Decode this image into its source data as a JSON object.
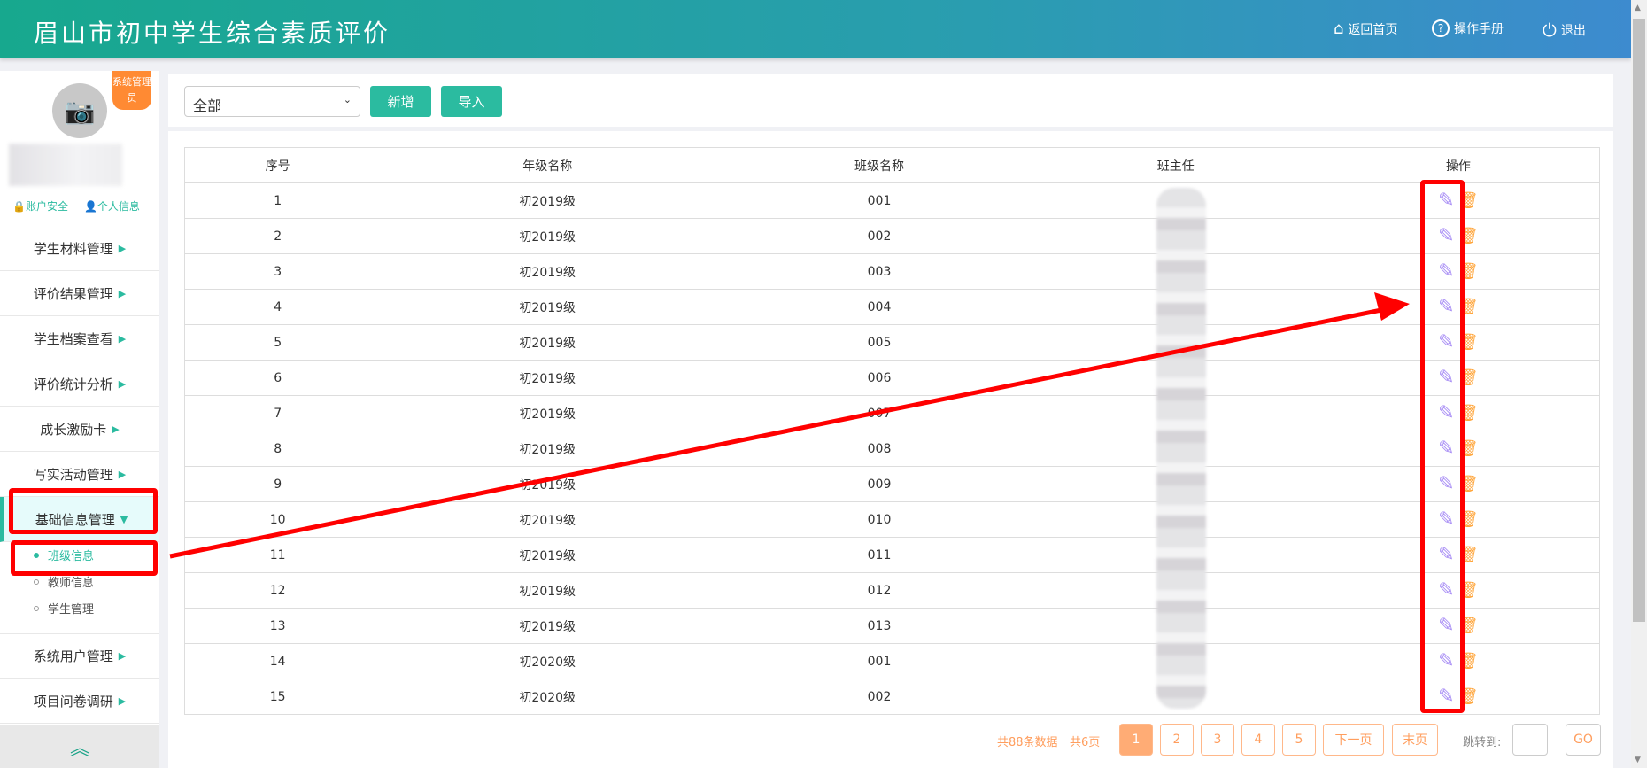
{
  "header": {
    "title": "眉山市初中学生综合素质评价",
    "nav": [
      {
        "icon": "home-icon",
        "label": "返回首页"
      },
      {
        "icon": "help-icon",
        "label": "操作手册"
      },
      {
        "icon": "power-icon",
        "label": "退出"
      }
    ]
  },
  "profile": {
    "role_badge": "系统管理员",
    "links": [
      "账户安全",
      "个人信息"
    ]
  },
  "sidebar": {
    "items": [
      "学生材料管理",
      "评价结果管理",
      "学生档案查看",
      "评价统计分析",
      "成长激励卡",
      "写实活动管理",
      "基础信息管理"
    ],
    "active": "基础信息管理",
    "sub_items": [
      "班级信息",
      "教师信息",
      "学生管理"
    ],
    "active_sub": "班级信息",
    "after_items": [
      "系统用户管理",
      "项目问卷调研"
    ]
  },
  "toolbar": {
    "select_value": "全部",
    "add_label": "新增",
    "import_label": "导入"
  },
  "table": {
    "headers": [
      "序号",
      "年级名称",
      "班级名称",
      "班主任",
      "操作"
    ],
    "rows": [
      [
        "1",
        "初2019级",
        "001"
      ],
      [
        "2",
        "初2019级",
        "002"
      ],
      [
        "3",
        "初2019级",
        "003"
      ],
      [
        "4",
        "初2019级",
        "004"
      ],
      [
        "5",
        "初2019级",
        "005"
      ],
      [
        "6",
        "初2019级",
        "006"
      ],
      [
        "7",
        "初2019级",
        "007"
      ],
      [
        "8",
        "初2019级",
        "008"
      ],
      [
        "9",
        "初2019级",
        "009"
      ],
      [
        "10",
        "初2019级",
        "010"
      ],
      [
        "11",
        "初2019级",
        "011"
      ],
      [
        "12",
        "初2019级",
        "012"
      ],
      [
        "13",
        "初2019级",
        "013"
      ],
      [
        "14",
        "初2020级",
        "001"
      ],
      [
        "15",
        "初2020级",
        "002"
      ]
    ]
  },
  "pagination": {
    "total": "共88条数据",
    "pages": "共6页",
    "page_buttons": [
      "1",
      "2",
      "3",
      "4",
      "5"
    ],
    "current": "1",
    "next": "下一页",
    "last": "末页",
    "jump_label": "跳转到:",
    "go": "GO"
  },
  "colors": {
    "primary": "#2bbba0",
    "accent": "#ff9e5e",
    "edit": "#a98ff5",
    "delete": "#ffa53a",
    "annotation": "#ff0000"
  }
}
